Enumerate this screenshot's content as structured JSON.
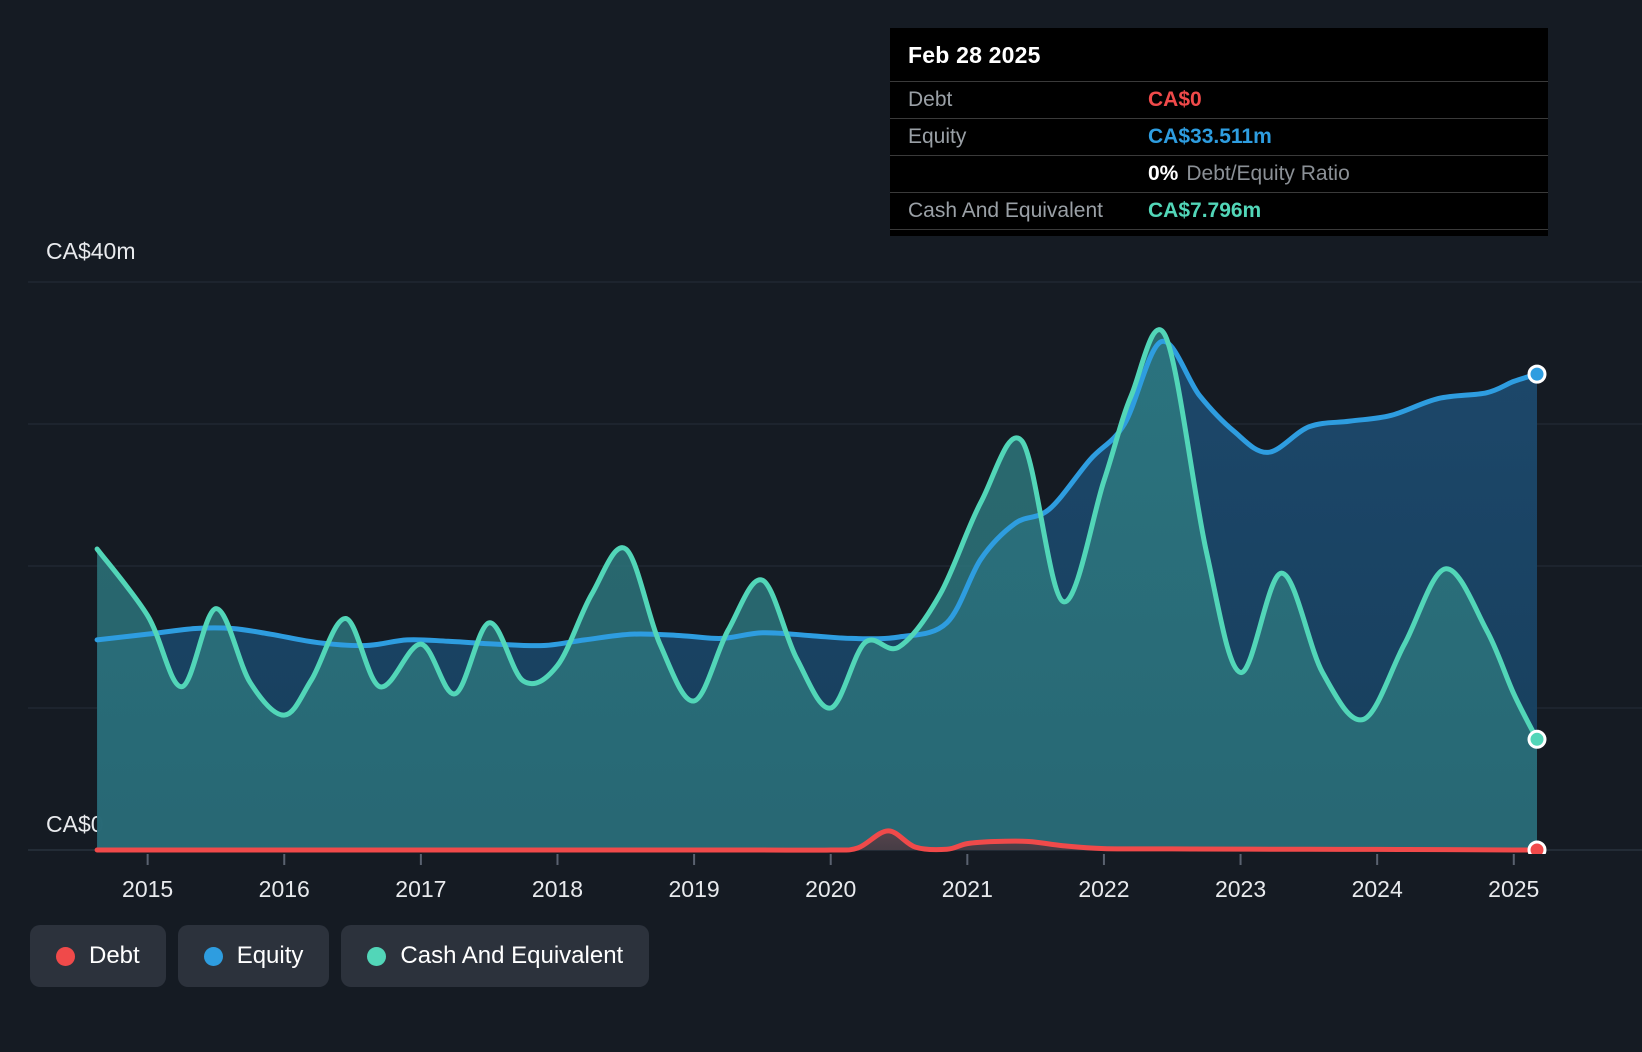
{
  "tooltip": {
    "date": "Feb 28 2025",
    "rows": [
      {
        "label": "Debt",
        "value": "CA$0"
      },
      {
        "label": "Equity",
        "value": "CA$33.511m"
      }
    ],
    "ratio": {
      "value": "0%",
      "label": "Debt/Equity Ratio"
    },
    "cash": {
      "label": "Cash And Equivalent",
      "value": "CA$7.796m"
    }
  },
  "axis": {
    "y_top_label": "CA$40m",
    "y_bottom_label": "CA$0",
    "x_ticks": [
      "2015",
      "2016",
      "2017",
      "2018",
      "2019",
      "2020",
      "2021",
      "2022",
      "2023",
      "2024",
      "2025"
    ]
  },
  "legend": [
    {
      "name": "Debt",
      "color": "#f04a4a"
    },
    {
      "name": "Equity",
      "color": "#2e9de0"
    },
    {
      "name": "Cash And Equivalent",
      "color": "#52d6b8"
    }
  ],
  "colors": {
    "background": "#151b23",
    "debt": "#f04a4a",
    "equity": "#2e9de0",
    "cash": "#52d6b8",
    "gridline": "#2b3440",
    "tooltip_bg": "#000000"
  },
  "chart_data": {
    "type": "area",
    "title": "",
    "xlabel": "",
    "ylabel": "CA$",
    "ylim": [
      0,
      40
    ],
    "xlim": [
      2014.6,
      2025.17
    ],
    "grid": true,
    "legend_position": "bottom-left",
    "y_ticks": [
      0,
      10,
      20,
      30,
      40
    ],
    "x_ticks": [
      2015,
      2016,
      2017,
      2018,
      2019,
      2020,
      2021,
      2022,
      2023,
      2024,
      2025
    ],
    "units": "CA$ millions",
    "series": [
      {
        "name": "Debt",
        "color": "#f04a4a",
        "x": [
          2014.63,
          2015.0,
          2015.5,
          2016.0,
          2016.5,
          2017.0,
          2017.5,
          2018.0,
          2018.5,
          2019.0,
          2019.5,
          2020.0,
          2020.2,
          2020.42,
          2020.62,
          2020.85,
          2021.0,
          2021.2,
          2021.45,
          2021.7,
          2022.0,
          2022.5,
          2023.0,
          2023.5,
          2024.0,
          2024.5,
          2025.0,
          2025.17
        ],
        "values": [
          0,
          0,
          0,
          0,
          0,
          0,
          0,
          0,
          0,
          0,
          0,
          0,
          0.15,
          1.35,
          0.2,
          0.05,
          0.45,
          0.6,
          0.6,
          0.3,
          0.1,
          0.08,
          0.06,
          0.05,
          0.04,
          0.03,
          0.0,
          0.0
        ]
      },
      {
        "name": "Equity",
        "color": "#2e9de0",
        "x": [
          2014.63,
          2015.0,
          2015.35,
          2015.62,
          2015.9,
          2016.25,
          2016.6,
          2016.9,
          2017.2,
          2017.55,
          2017.9,
          2018.2,
          2018.55,
          2018.9,
          2019.2,
          2019.5,
          2019.85,
          2020.15,
          2020.5,
          2020.85,
          2021.1,
          2021.35,
          2021.6,
          2021.9,
          2022.15,
          2022.42,
          2022.7,
          2022.95,
          2023.2,
          2023.5,
          2023.8,
          2024.1,
          2024.45,
          2024.8,
          2025.0,
          2025.17
        ],
        "values": [
          14.8,
          15.2,
          15.6,
          15.6,
          15.2,
          14.6,
          14.4,
          14.8,
          14.7,
          14.5,
          14.4,
          14.8,
          15.2,
          15.1,
          14.9,
          15.3,
          15.1,
          14.9,
          15.0,
          16.0,
          20.5,
          23.0,
          24.0,
          27.5,
          30.0,
          35.8,
          32.0,
          29.5,
          28.0,
          29.8,
          30.2,
          30.6,
          31.8,
          32.2,
          33.0,
          33.511
        ]
      },
      {
        "name": "Cash And Equivalent",
        "color": "#52d6b8",
        "x": [
          2014.63,
          2015.0,
          2015.25,
          2015.5,
          2015.75,
          2016.0,
          2016.2,
          2016.45,
          2016.7,
          2017.0,
          2017.25,
          2017.5,
          2017.75,
          2018.0,
          2018.25,
          2018.5,
          2018.75,
          2019.0,
          2019.25,
          2019.5,
          2019.75,
          2020.0,
          2020.25,
          2020.5,
          2020.8,
          2021.1,
          2021.4,
          2021.7,
          2022.0,
          2022.2,
          2022.45,
          2022.75,
          2023.0,
          2023.3,
          2023.6,
          2023.9,
          2024.2,
          2024.5,
          2024.8,
          2025.0,
          2025.17
        ],
        "values": [
          21.2,
          16.5,
          11.5,
          17.0,
          11.8,
          9.5,
          12.0,
          16.3,
          11.5,
          14.5,
          11.0,
          16.0,
          11.9,
          13.0,
          18.0,
          21.2,
          14.5,
          10.5,
          15.5,
          19.0,
          13.5,
          10.0,
          14.6,
          14.3,
          18.0,
          24.5,
          28.8,
          17.5,
          26.0,
          32.0,
          36.2,
          21.0,
          12.5,
          19.5,
          12.5,
          9.2,
          14.5,
          19.8,
          15.5,
          11.0,
          7.796
        ]
      }
    ]
  }
}
